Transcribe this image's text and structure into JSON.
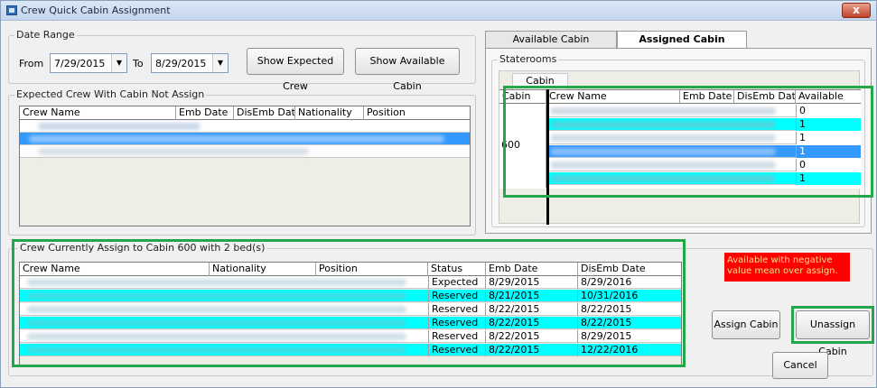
{
  "window": {
    "title": "Crew Quick Cabin Assignment",
    "close_label": "x"
  },
  "date_range": {
    "legend": "Date Range",
    "from_label": "From",
    "from_value": "7/29/2015",
    "to_label": "To",
    "to_value": "8/29/2015"
  },
  "buttons": {
    "show_expected_crew": "Show Expected Crew",
    "show_available_cabin": "Show Available Cabin",
    "assign_cabin": "Assign Cabin",
    "unassign_cabin": "Unassign Cabin",
    "cancel": "Cancel"
  },
  "expected_crew": {
    "legend": "Expected Crew With Cabin Not Assign",
    "columns": [
      "Crew Name",
      "Emb Date",
      "DisEmb Date",
      "Nationality",
      "Position"
    ]
  },
  "tabs": [
    {
      "label": "Available Cabin",
      "active": false
    },
    {
      "label": "Assigned Cabin",
      "active": true
    }
  ],
  "staterooms": {
    "legend": "Staterooms",
    "cabin_column_label": "Cabin",
    "columns": [
      "Cabin",
      "Crew Name",
      "Emb Date",
      "DisEmb Date",
      "Available"
    ],
    "cabin_value": "600",
    "available": [
      "0",
      "1",
      "1",
      "1",
      "0",
      "1"
    ]
  },
  "assigned": {
    "legend": "Crew Currently Assign to Cabin 600 with 2 bed(s)",
    "columns": [
      "Crew Name",
      "Nationality",
      "Position",
      "Status",
      "Emb Date",
      "DisEmb Date"
    ],
    "rows": [
      {
        "status": "Expected",
        "emb": "8/29/2015",
        "disemb": "8/29/2016"
      },
      {
        "status": "Reserved",
        "emb": "8/21/2015",
        "disemb": "10/31/2016"
      },
      {
        "status": "Reserved",
        "emb": "8/22/2015",
        "disemb": "8/22/2015"
      },
      {
        "status": "Reserved",
        "emb": "8/22/2015",
        "disemb": "8/22/2015"
      },
      {
        "status": "Reserved",
        "emb": "8/22/2015",
        "disemb": "8/29/2015"
      },
      {
        "status": "Reserved",
        "emb": "8/22/2015",
        "disemb": "12/22/2016"
      }
    ]
  },
  "warning": {
    "text": "Available with negative value mean over assign."
  },
  "colors": {
    "highlight_cyan": "#00ffff",
    "selection_blue": "#3399ff",
    "callout_green": "#22a84a",
    "warning_red": "#ff0000"
  }
}
